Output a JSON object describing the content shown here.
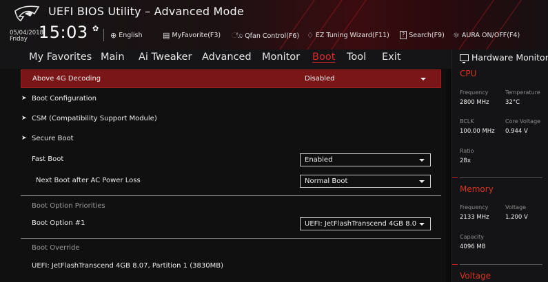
{
  "header": {
    "app_title": "UEFI BIOS Utility – Advanced Mode",
    "date": "05/04/2018",
    "day": "Friday",
    "time": "15:03",
    "toolbar": {
      "language": "English",
      "myfavorite": "MyFavorite(F3)",
      "qfan": "Qfan Control(F6)",
      "ez_tuning": "EZ Tuning Wizard(F11)",
      "search_key": "?",
      "search": "Search(F9)",
      "aura": "AURA ON/OFF(F4)"
    }
  },
  "tabs": [
    "My Favorites",
    "Main",
    "Ai Tweaker",
    "Advanced",
    "Monitor",
    "Boot",
    "Tool",
    "Exit"
  ],
  "active_tab": "Boot",
  "main": {
    "above4g": {
      "label": "Above 4G Decoding",
      "value": "Disabled"
    },
    "boot_configuration": "Boot Configuration",
    "csm": "CSM (Compatibility Support Module)",
    "secure_boot": "Secure Boot",
    "fast_boot": {
      "label": "Fast Boot",
      "value": "Enabled"
    },
    "next_boot": {
      "label": "Next Boot after AC Power Loss",
      "value": "Normal Boot"
    },
    "boot_option_priorities": "Boot Option Priorities",
    "boot_option_1": {
      "label": "Boot Option #1",
      "value": "UEFI: JetFlashTranscend 4GB 8.0"
    },
    "boot_override": "Boot Override",
    "override_item": "UEFI: JetFlashTranscend 4GB 8.07, Partition 1 (3830MB)"
  },
  "hardware_monitor": {
    "title": "Hardware Monitor",
    "cpu": {
      "heading": "CPU",
      "frequency_label": "Frequency",
      "frequency": "2800 MHz",
      "temperature_label": "Temperature",
      "temperature": "32°C",
      "bclk_label": "BCLK",
      "bclk": "100.00 MHz",
      "core_voltage_label": "Core Voltage",
      "core_voltage": "0.944 V",
      "ratio_label": "Ratio",
      "ratio": "28x"
    },
    "memory": {
      "heading": "Memory",
      "frequency_label": "Frequency",
      "frequency": "2133 MHz",
      "voltage_label": "Voltage",
      "voltage": "1.200 V",
      "capacity_label": "Capacity",
      "capacity": "4096 MB"
    },
    "voltage": {
      "heading": "Voltage"
    }
  },
  "colors": {
    "accent_red": "#e02a2a",
    "selected_row": "#7a1618",
    "heading_red": "#d8341f"
  }
}
